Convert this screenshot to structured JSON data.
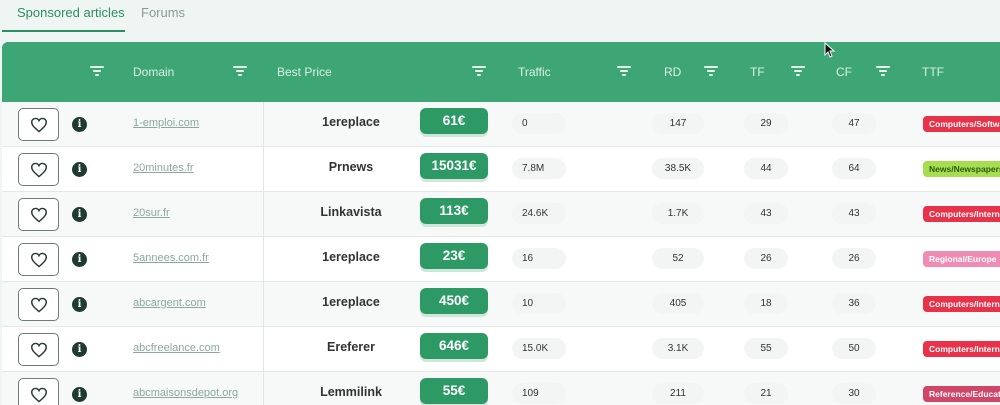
{
  "tabs": [
    {
      "label": "Sponsored articles",
      "active": true
    },
    {
      "label": "Forums",
      "active": false
    }
  ],
  "columns": {
    "domain": "Domain",
    "best_price": "Best Price",
    "traffic": "Traffic",
    "rd": "RD",
    "tf": "TF",
    "cf": "CF",
    "ttf": "TTF"
  },
  "colors": {
    "header_bg": "#3ea674",
    "price_bg": "#2d9a66",
    "ttf_red": "#e8324a",
    "ttf_green": "#a6de4f",
    "ttf_pink": "#f08cb4",
    "ttf_rose": "#cf4668"
  },
  "icons": [
    "filter-icon",
    "heart-icon",
    "info-icon",
    "mouse-cursor-icon"
  ],
  "rows": [
    {
      "domain": "1-emploi.com",
      "provider": "1ereplace",
      "price": "61€",
      "traffic": "0",
      "rd": "147",
      "tf": "29",
      "cf": "47",
      "ttf": "Computers/Software",
      "ttf_color": "#e8324a",
      "ttf_text_color": "#ffffff"
    },
    {
      "domain": "20minutes.fr",
      "provider": "Prnews",
      "price": "15031€",
      "traffic": "7.8M",
      "rd": "38.5K",
      "tf": "44",
      "cf": "64",
      "ttf": "News/Newspapers",
      "ttf_color": "#a6de4f",
      "ttf_text_color": "#2f5a14"
    },
    {
      "domain": "20sur.fr",
      "provider": "Linkavista",
      "price": "113€",
      "traffic": "24.6K",
      "rd": "1.7K",
      "tf": "43",
      "cf": "43",
      "ttf": "Computers/Internet",
      "ttf_color": "#e8324a",
      "ttf_text_color": "#ffffff"
    },
    {
      "domain": "5annees.com.fr",
      "provider": "1ereplace",
      "price": "23€",
      "traffic": "16",
      "rd": "52",
      "tf": "26",
      "cf": "26",
      "ttf": "Regional/Europe",
      "ttf_color": "#f08cb4",
      "ttf_text_color": "#ffffff"
    },
    {
      "domain": "abcargent.com",
      "provider": "1ereplace",
      "price": "450€",
      "traffic": "10",
      "rd": "405",
      "tf": "18",
      "cf": "36",
      "ttf": "Computers/Internet",
      "ttf_color": "#e8324a",
      "ttf_text_color": "#ffffff"
    },
    {
      "domain": "abcfreelance.com",
      "provider": "Ereferer",
      "price": "646€",
      "traffic": "15.0K",
      "rd": "3.1K",
      "tf": "55",
      "cf": "50",
      "ttf": "Computers/Internet",
      "ttf_color": "#e8324a",
      "ttf_text_color": "#ffffff"
    },
    {
      "domain": "abcmaisonsdepot.org",
      "provider": "Lemmilink",
      "price": "55€",
      "traffic": "109",
      "rd": "211",
      "tf": "21",
      "cf": "30",
      "ttf": "Reference/Education",
      "ttf_color": "#cf4668",
      "ttf_text_color": "#ffffff"
    }
  ]
}
